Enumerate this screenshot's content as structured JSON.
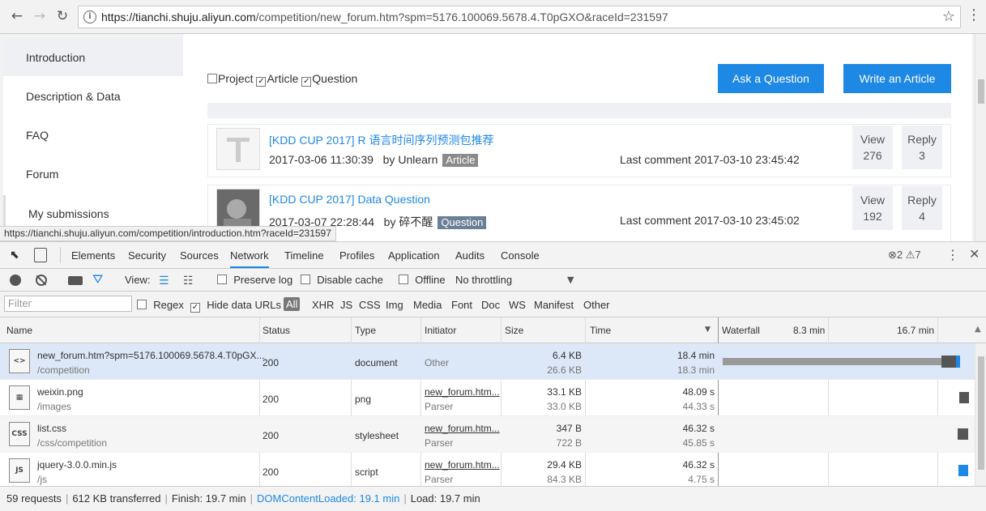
{
  "browser": {
    "url_scheme_host": "https://tianchi.shuju.aliyun.com",
    "url_rest": "/competition/new_forum.htm?spm=5176.100069.5678.4.T0pGXO&raceId=231597"
  },
  "sidebar": {
    "items": [
      {
        "label": "Introduction"
      },
      {
        "label": "Description & Data"
      },
      {
        "label": "FAQ"
      },
      {
        "label": "Forum"
      },
      {
        "label": "My submissions"
      }
    ]
  },
  "forum": {
    "filters": [
      {
        "label": "Project",
        "checked": false
      },
      {
        "label": "Article",
        "checked": true
      },
      {
        "label": "Question",
        "checked": true
      }
    ],
    "ask_button": "Ask a Question",
    "write_button": "Write an Article",
    "posts": [
      {
        "title": "[KDD CUP 2017] R 语言时间序列预测包推荐",
        "date": "2017-03-06 11:30:39",
        "by": "by",
        "author": "Unlearn",
        "tag": "Article",
        "last_comment": "Last comment 2017-03-10 23:45:42",
        "view_label": "View",
        "views": "276",
        "reply_label": "Reply",
        "replies": "3"
      },
      {
        "title": "[KDD CUP 2017] Data Question",
        "date": "2017-03-07 22:28:44",
        "by": "by",
        "author": "碎不醒",
        "tag": "Question",
        "last_comment": "Last comment 2017-03-10 23:45:02",
        "view_label": "View",
        "views": "192",
        "reply_label": "Reply",
        "replies": "4"
      }
    ]
  },
  "hover_link": "https://tianchi.shuju.aliyun.com/competition/introduction.htm?raceId=231597",
  "devtools": {
    "tabs": [
      "Elements",
      "Security",
      "Sources",
      "Network",
      "Timeline",
      "Profiles",
      "Application",
      "Audits",
      "Console"
    ],
    "active_tab": "Network",
    "errors": "2",
    "warnings": "7",
    "toolbar": {
      "view_label": "View:",
      "preserve_log": "Preserve log",
      "disable_cache": "Disable cache",
      "offline": "Offline",
      "throttling": "No throttling"
    },
    "filter": {
      "placeholder": "Filter",
      "regex": "Regex",
      "hide_data_urls": "Hide data URLs",
      "types": [
        "All",
        "XHR",
        "JS",
        "CSS",
        "Img",
        "Media",
        "Font",
        "Doc",
        "WS",
        "Manifest",
        "Other"
      ]
    },
    "columns": {
      "name": "Name",
      "status": "Status",
      "type": "Type",
      "initiator": "Initiator",
      "size": "Size",
      "time": "Time",
      "waterfall": "Waterfall",
      "tick1": "8.3 min",
      "tick2": "16.7 min"
    },
    "rows": [
      {
        "name": "new_forum.htm?spm=5176.100069.5678.4.T0pGX...",
        "path": "/competition",
        "icon": "html-file-icon",
        "icon_text": "<>",
        "status": "200",
        "type": "document",
        "initiator": "Other",
        "initiator_sub": "",
        "size": "6.4 KB",
        "size_sub": "26.6 KB",
        "time": "18.4 min",
        "time_sub": "18.3 min"
      },
      {
        "name": "weixin.png",
        "path": "/images",
        "icon": "image-file-icon",
        "icon_text": "▦",
        "status": "200",
        "type": "png",
        "initiator": "new_forum.htm...",
        "initiator_sub": "Parser",
        "size": "33.1 KB",
        "size_sub": "33.0 KB",
        "time": "48.09 s",
        "time_sub": "44.33 s"
      },
      {
        "name": "list.css",
        "path": "/css/competition",
        "icon": "css-file-icon",
        "icon_text": "CSS",
        "status": "200",
        "type": "stylesheet",
        "initiator": "new_forum.htm...",
        "initiator_sub": "Parser",
        "size": "347 B",
        "size_sub": "722 B",
        "time": "46.32 s",
        "time_sub": "45.85 s"
      },
      {
        "name": "jquery-3.0.0.min.js",
        "path": "/js",
        "icon": "js-file-icon",
        "icon_text": "JS",
        "status": "200",
        "type": "script",
        "initiator": "new_forum.htm...",
        "initiator_sub": "Parser",
        "size": "29.4 KB",
        "size_sub": "84.3 KB",
        "time": "46.32 s",
        "time_sub": "4.75 s"
      }
    ],
    "status": {
      "requests": "59 requests",
      "transferred": "612 KB transferred",
      "finish": "Finish: 19.7 min",
      "dcl": "DOMContentLoaded: 19.1 min",
      "load": "Load: 19.7 min"
    }
  }
}
